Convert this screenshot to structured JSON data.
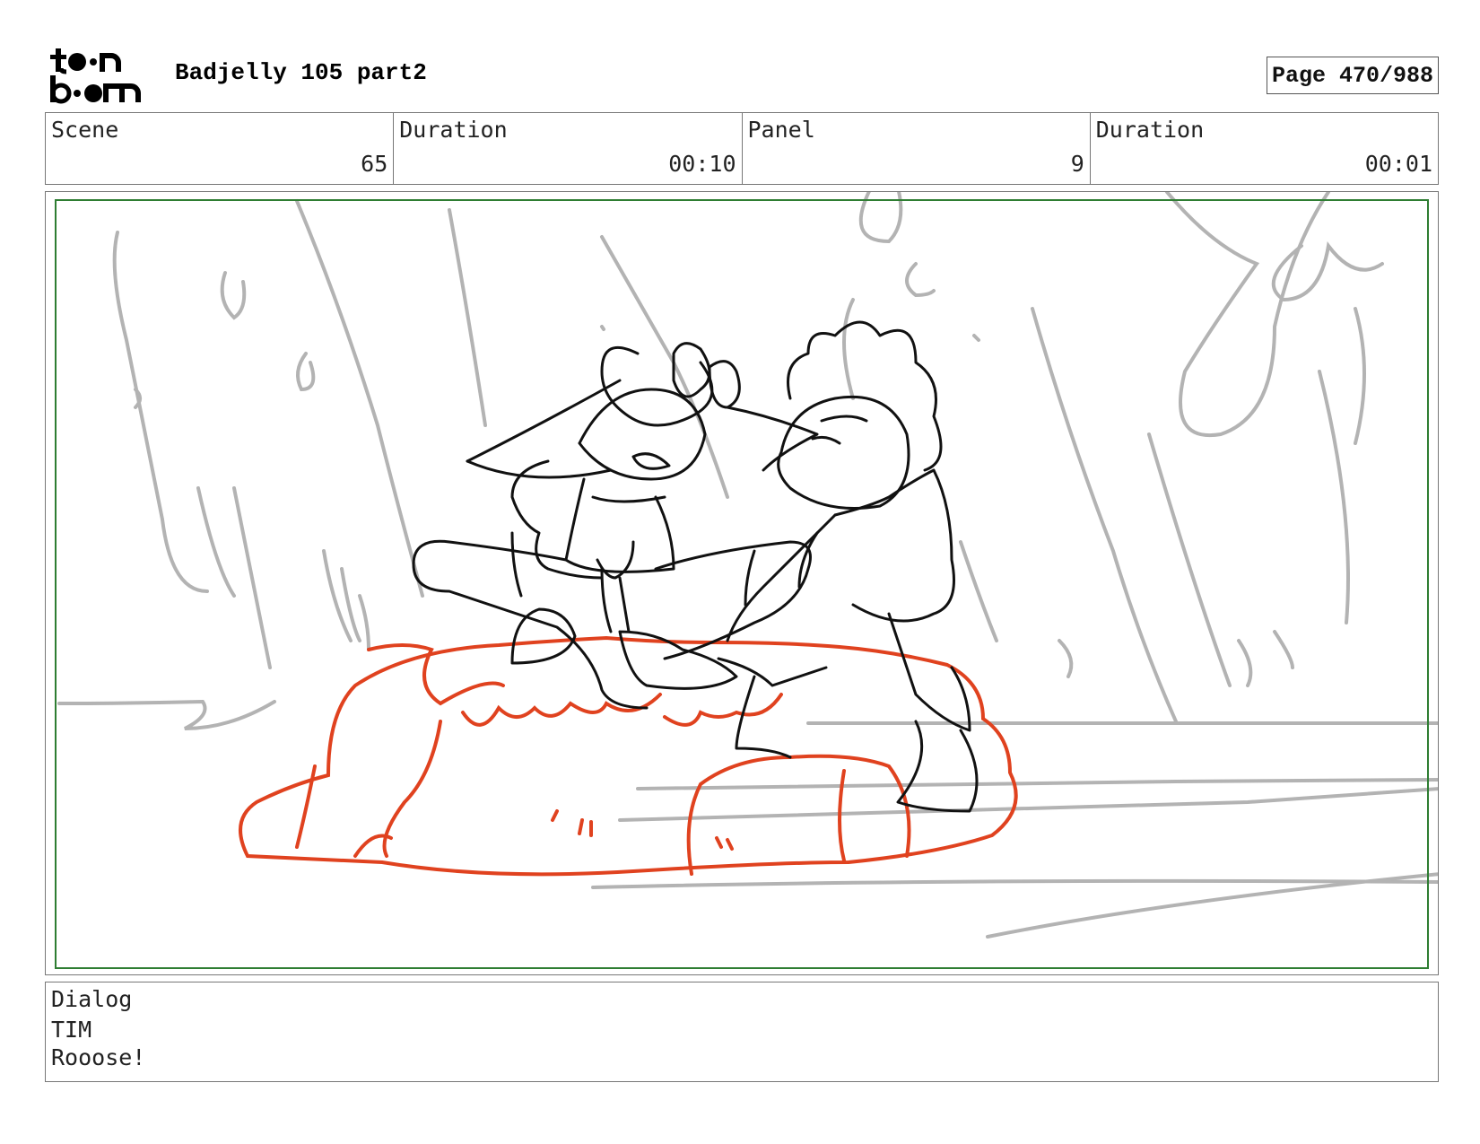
{
  "logo": {
    "text": "toon boom",
    "icon": "toon-boom-logo"
  },
  "header": {
    "title": "Badjelly 105 part2",
    "page": "Page 470/988"
  },
  "info": {
    "scene_label": "Scene",
    "scene_value": "65",
    "duration_label": "Duration",
    "duration_value": "00:10",
    "panel_label": "Panel",
    "panel_value": "9",
    "panel_duration_label": "Duration",
    "panel_duration_value": "00:01"
  },
  "panel": {
    "image": "storyboard-sketch",
    "colors": {
      "sketch": "#111111",
      "background_lines": "#b3b3b3",
      "rock": "#e0421f",
      "safe_frame": "#2e7d32"
    }
  },
  "dialog": {
    "label": "Dialog",
    "character": "TIM",
    "line": "Rooose!"
  }
}
